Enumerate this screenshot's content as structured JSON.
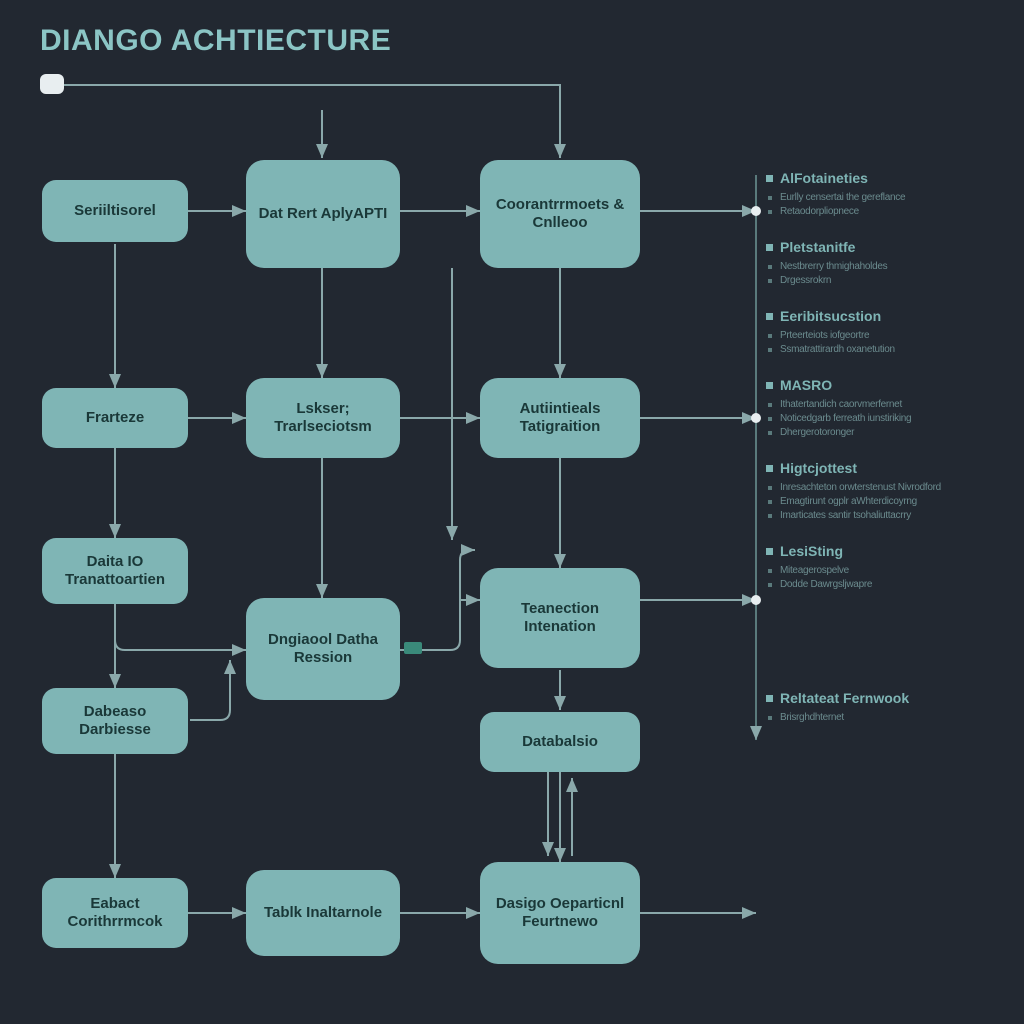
{
  "title": "DIANGO ACHTIECTURE",
  "nodes": {
    "n_seriltisorel": "Seriiltisorel",
    "n_dat_rert": "Dat Rert AplyAPTI",
    "n_coorantrmets": "Coorantrrmoets & Cnlleoo",
    "n_prateze": "Frarteze",
    "n_lskser": "Lskser; Trarlseciotsm",
    "n_autiintieals": "Autiintieals Tatigraition",
    "n_data_io": "Daita IO Tranattoartien",
    "n_dngaool": "Dngiaool Datha Ression",
    "n_teanection": "Teanection Intenation",
    "n_dabease": "Dabeaso Darbiesse",
    "n_databelsio": "Databalsio",
    "n_eabact": "Eabact Corithrrmcok",
    "n_tablk": "Tablk Inaltarnole",
    "n_dasigo": "Dasigo Oeparticnl Feurtnewo"
  },
  "legend": [
    {
      "title": "AlFotaineties",
      "items": [
        "Eurlly censertai the gereflance",
        "Retaodorpliopnece"
      ]
    },
    {
      "title": "Pletstanitfe",
      "items": [
        "Nestbrerry thmighaholdes",
        "Drgessrokrn"
      ]
    },
    {
      "title": "Eeribitsucstion",
      "items": [
        "Prteerteiots iofgeortre",
        "Ssmatrattirardh oxanetution"
      ]
    },
    {
      "title": "MASRO",
      "items": [
        "Ithatertandich caorvmerfernet",
        "Noticedgarb ferreath iunstiriking",
        "Dhergerotoronger"
      ]
    },
    {
      "title": "Higtcjottest",
      "items": [
        "Inresachteton orwterstenust Nivrodford",
        "Emagtirunt ogplr aWhterdicoyrng",
        "Imarticates santir tsohaliuttacrry"
      ]
    },
    {
      "title": "LesiSting",
      "items": [
        "Miteagerospelve",
        "Dodde Dawrgsljwapre"
      ]
    },
    {
      "title": "Reltateat Fernwook",
      "items": [
        "Brisrghdhternet"
      ]
    }
  ],
  "colors": {
    "bg": "#222831",
    "node": "#7fb5b5",
    "text": "#1a3838",
    "accent": "#8bc5c5",
    "line": "#8aa8aa"
  }
}
